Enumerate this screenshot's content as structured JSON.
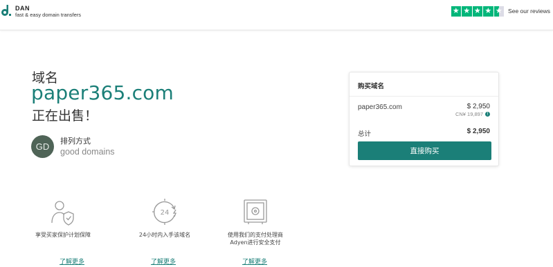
{
  "header": {
    "logo_name": "DAN",
    "logo_tagline": "fast & easy domain transfers",
    "trust_label": "See our reviews",
    "star_color": "#00b67a",
    "rating_stars": 4.5
  },
  "hero": {
    "heading": "域名",
    "domain": "paper365.com",
    "for_sale": "正在出售！"
  },
  "seller": {
    "avatar_initials": "GD",
    "sort_label": "排列方式",
    "name": "good domains"
  },
  "card": {
    "title": "购买域名",
    "item_name": "paper365.com",
    "item_price": "$ 2,950",
    "item_price_cny": "CN¥ 19,897",
    "total_label": "总计",
    "total_price": "$ 2,950",
    "buy_label": "直接购买"
  },
  "features": [
    {
      "icon": "shield-user-icon",
      "text_line1": "享受买家保护计划保障",
      "text_line2": "",
      "link": "了解更多"
    },
    {
      "icon": "clock-24-icon",
      "text_line1": "24小时内入手该域名",
      "text_line2": "",
      "link": "了解更多"
    },
    {
      "icon": "safe-icon",
      "text_line1": "使用我们的支付处理商",
      "text_line2": "Adyen进行安全支付",
      "link": "了解更多"
    }
  ],
  "colors": {
    "accent": "#1b7f78",
    "avatar_bg": "#4f6457"
  }
}
